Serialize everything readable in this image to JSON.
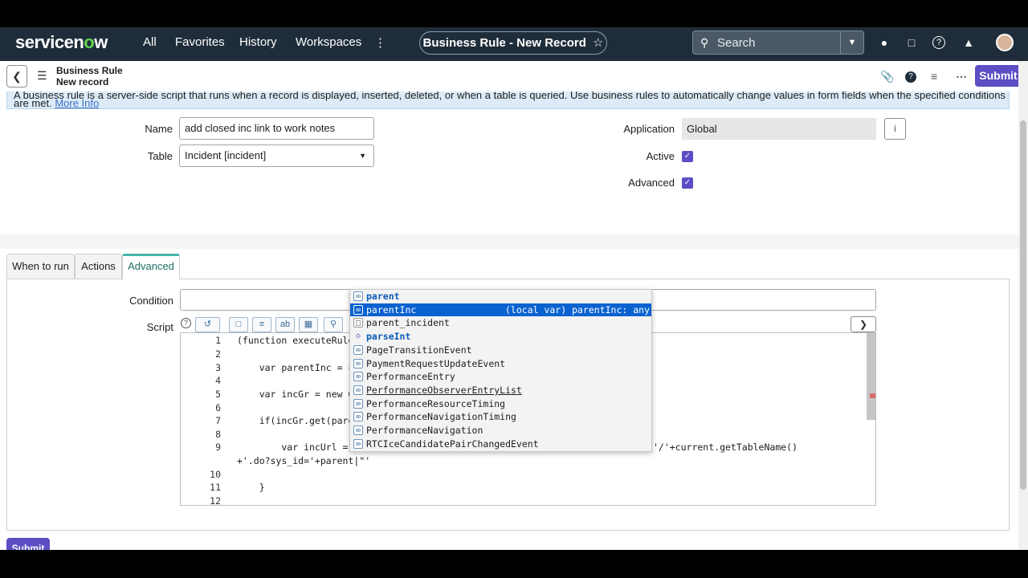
{
  "nav": {
    "logo_text": "servicenow",
    "links": [
      "All",
      "Favorites",
      "History",
      "Workspaces"
    ],
    "more_icon": "vertical-dots-icon",
    "title": "Business Rule - New Record",
    "title_star": "☆",
    "search_placeholder": "Search",
    "icons": [
      "globe-icon",
      "chat-icon",
      "help-icon",
      "bell-icon"
    ]
  },
  "header": {
    "record_type": "Business Rule",
    "record_name": "New record",
    "submit_label": "Submit"
  },
  "info_banner": {
    "text": "A business rule is a server-side script that runs when a record is displayed, inserted, deleted, or when a table is queried. Use business rules to automatically change values in form fields when the specified conditions are met.",
    "link": "More Info"
  },
  "form": {
    "name_label": "Name",
    "name_value": "add closed inc link to work notes",
    "table_label": "Table",
    "table_value": "Incident [incident]",
    "application_label": "Application",
    "application_value": "Global",
    "active_label": "Active",
    "advanced_label": "Advanced"
  },
  "tabs": [
    "When to run",
    "Actions",
    "Advanced"
  ],
  "advanced": {
    "condition_label": "Condition",
    "script_label": "Script"
  },
  "editor": {
    "lines": [
      {
        "n": "1",
        "code": "(function executeRule"
      },
      {
        "n": "2",
        "code": ""
      },
      {
        "n": "3",
        "code": "    var parentInc = c"
      },
      {
        "n": "4",
        "code": ""
      },
      {
        "n": "5",
        "code": "    var incGr = new G"
      },
      {
        "n": "6",
        "code": ""
      },
      {
        "n": "7",
        "code": "    if(incGr.get(pare"
      },
      {
        "n": "8",
        "code": ""
      },
      {
        "n": "9",
        "code": "        var incUrl ="
      },
      {
        "n": "",
        "code": "+'.do?sys_id='+parent|\"'"
      },
      {
        "n": "10",
        "code": ""
      },
      {
        "n": "11",
        "code": "    }"
      },
      {
        "n": "12",
        "code": ""
      }
    ],
    "line9_tail": "'/'+current.getTableName()"
  },
  "autocomplete": [
    {
      "text": "parent",
      "detail": ""
    },
    {
      "text": "parentInc",
      "detail": "(local var) parentInc: any"
    },
    {
      "text": "parent_incident",
      "detail": ""
    },
    {
      "text": "parseInt",
      "detail": ""
    },
    {
      "text": "PageTransitionEvent",
      "detail": ""
    },
    {
      "text": "PaymentRequestUpdateEvent",
      "detail": ""
    },
    {
      "text": "PerformanceEntry",
      "detail": ""
    },
    {
      "text": "PerformanceObserverEntryList",
      "detail": ""
    },
    {
      "text": "PerformanceResourceTiming",
      "detail": ""
    },
    {
      "text": "PerformanceNavigationTiming",
      "detail": ""
    },
    {
      "text": "PerformanceNavigation",
      "detail": ""
    },
    {
      "text": "RTCIceCandidatePairChangedEvent",
      "detail": ""
    }
  ],
  "footer": {
    "submit_label": "Submit"
  },
  "colors": {
    "nav_bg": "#1f2d3a",
    "accent": "#5c4ec4",
    "tab_accent": "#47b6a6",
    "selection": "#0a62d0"
  }
}
